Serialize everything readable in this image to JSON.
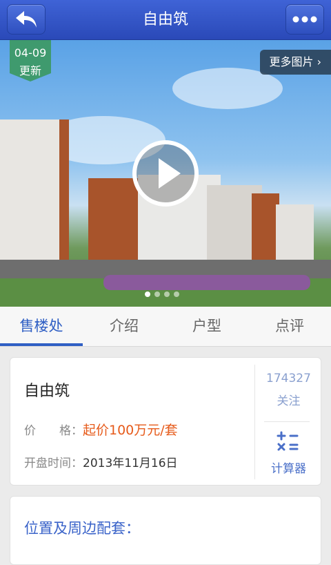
{
  "header": {
    "title": "自由筑",
    "back_icon": "back-arrow-icon",
    "more_icon": "more-dots-icon"
  },
  "hero": {
    "badge_date": "04-09",
    "badge_label": "更新",
    "more_pictures": "更多图片 ›",
    "play_icon": "play-icon",
    "slide_count": 4,
    "active_slide": 1
  },
  "tabs": [
    {
      "label": "售楼处",
      "active": true
    },
    {
      "label": "介绍",
      "active": false
    },
    {
      "label": "户型",
      "active": false
    },
    {
      "label": "点评",
      "active": false
    }
  ],
  "info": {
    "name": "自由筑",
    "price_label": "价　　格：",
    "price_value": "起价100万元/套",
    "open_label": "开盘时间：",
    "open_value": "2013年11月16日",
    "follow_count": "174327",
    "follow_label": "关注",
    "calculator_label": "计算器",
    "calculator_icon": "calculator-icon"
  },
  "location": {
    "title": "位置及周边配套："
  },
  "colors": {
    "brand": "#2f5fc4",
    "price": "#e65a1a",
    "badge": "#3f9a6e"
  }
}
